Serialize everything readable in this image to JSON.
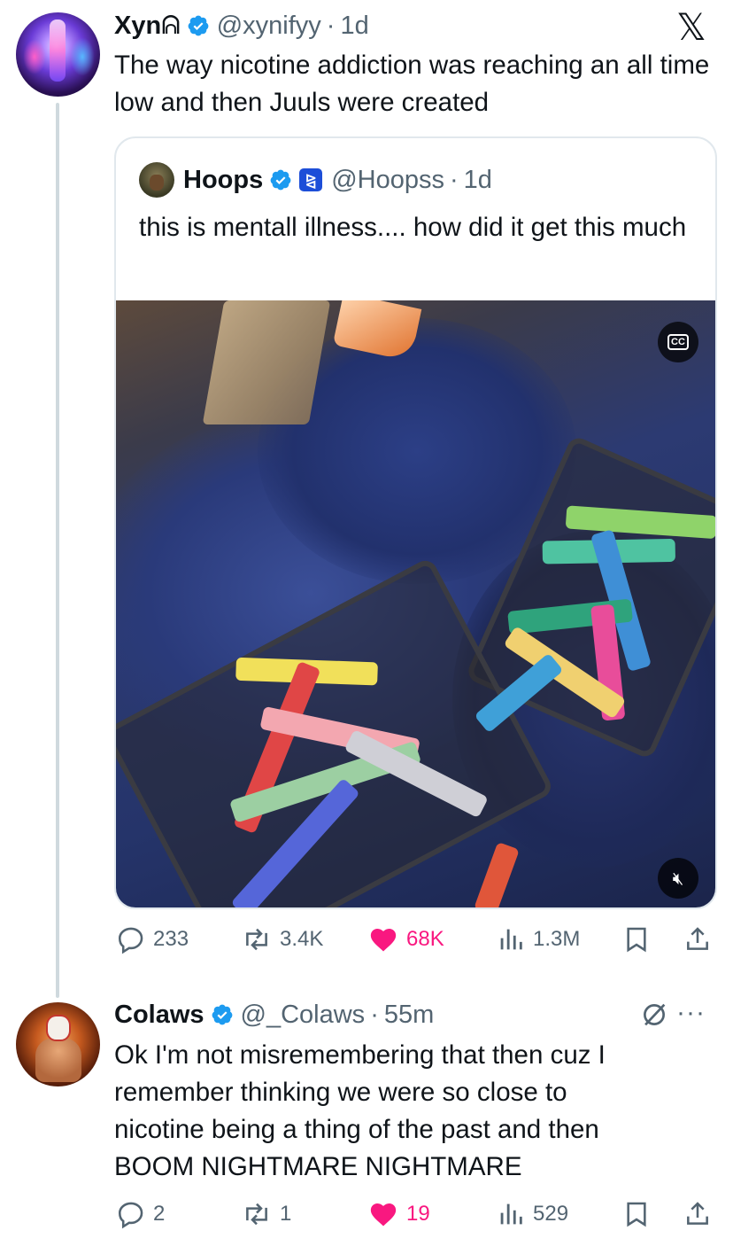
{
  "tweet1": {
    "display_name": "Xyn",
    "name_glyph": "ᕱ",
    "handle": "@xynifyy",
    "separator": "·",
    "time": "1d",
    "text": "The way nicotine addiction was reaching an all time low and then Juuls were created",
    "quote": {
      "display_name": "Hoops",
      "handle": "@Hoopss",
      "separator": "·",
      "time": "1d",
      "text": "this is mentall illness.... how did it get this much",
      "media": {
        "type": "video",
        "cc_label": "CC"
      }
    },
    "actions": {
      "replies": "233",
      "reposts": "3.4K",
      "likes": "68K",
      "views": "1.3M"
    }
  },
  "tweet2": {
    "display_name": "Colaws",
    "handle": "@_Colaws",
    "separator": "·",
    "time": "55m",
    "text_lines": [
      "Ok I'm not misremembering that then cuz I",
      "remember thinking we were so close to",
      "nicotine being a thing of the past and then",
      "BOOM NIGHTMARE NIGHTMARE"
    ],
    "more_label": "···",
    "actions": {
      "replies": "2",
      "reposts": "1",
      "likes": "19",
      "views": "529"
    }
  },
  "brand": {
    "logo": "𝕏"
  },
  "colors": {
    "text": "#0f1419",
    "muted": "#536471",
    "verified": "#1d9bf0",
    "like": "#f91880",
    "border": "#e1e8ed"
  },
  "icons": [
    "x-logo-icon",
    "verified-badge-icon",
    "government-badge-icon",
    "reply-icon",
    "repost-icon",
    "like-icon",
    "views-icon",
    "bookmark-icon",
    "share-icon",
    "cc-icon",
    "mute-icon",
    "grok-icon",
    "more-icon"
  ]
}
